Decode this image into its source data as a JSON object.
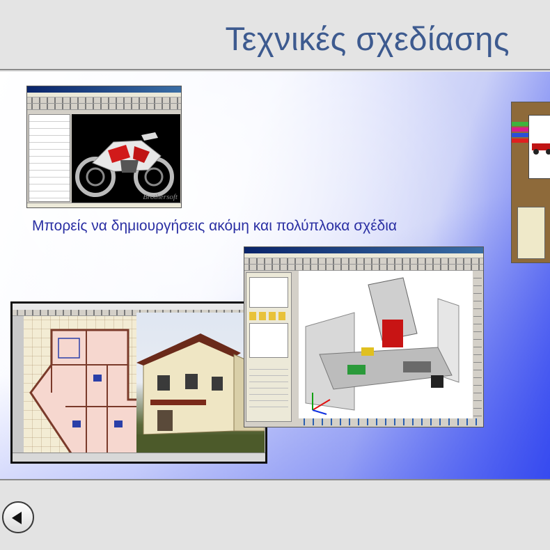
{
  "slide": {
    "title": "Τεχνικές σχεδίασης",
    "caption": "Μπορείς να δημιουργήσεις ακόμη και πολύπλοκα σχέδια"
  },
  "navigation": {
    "back_icon": "triangle-left-icon"
  },
  "screenshots": {
    "motorcycle": {
      "watermark": "Brothersoft"
    }
  },
  "colors": {
    "title": "#3d5a8f",
    "caption": "#2a2fa3",
    "gradient_end": "#2f43f0"
  }
}
